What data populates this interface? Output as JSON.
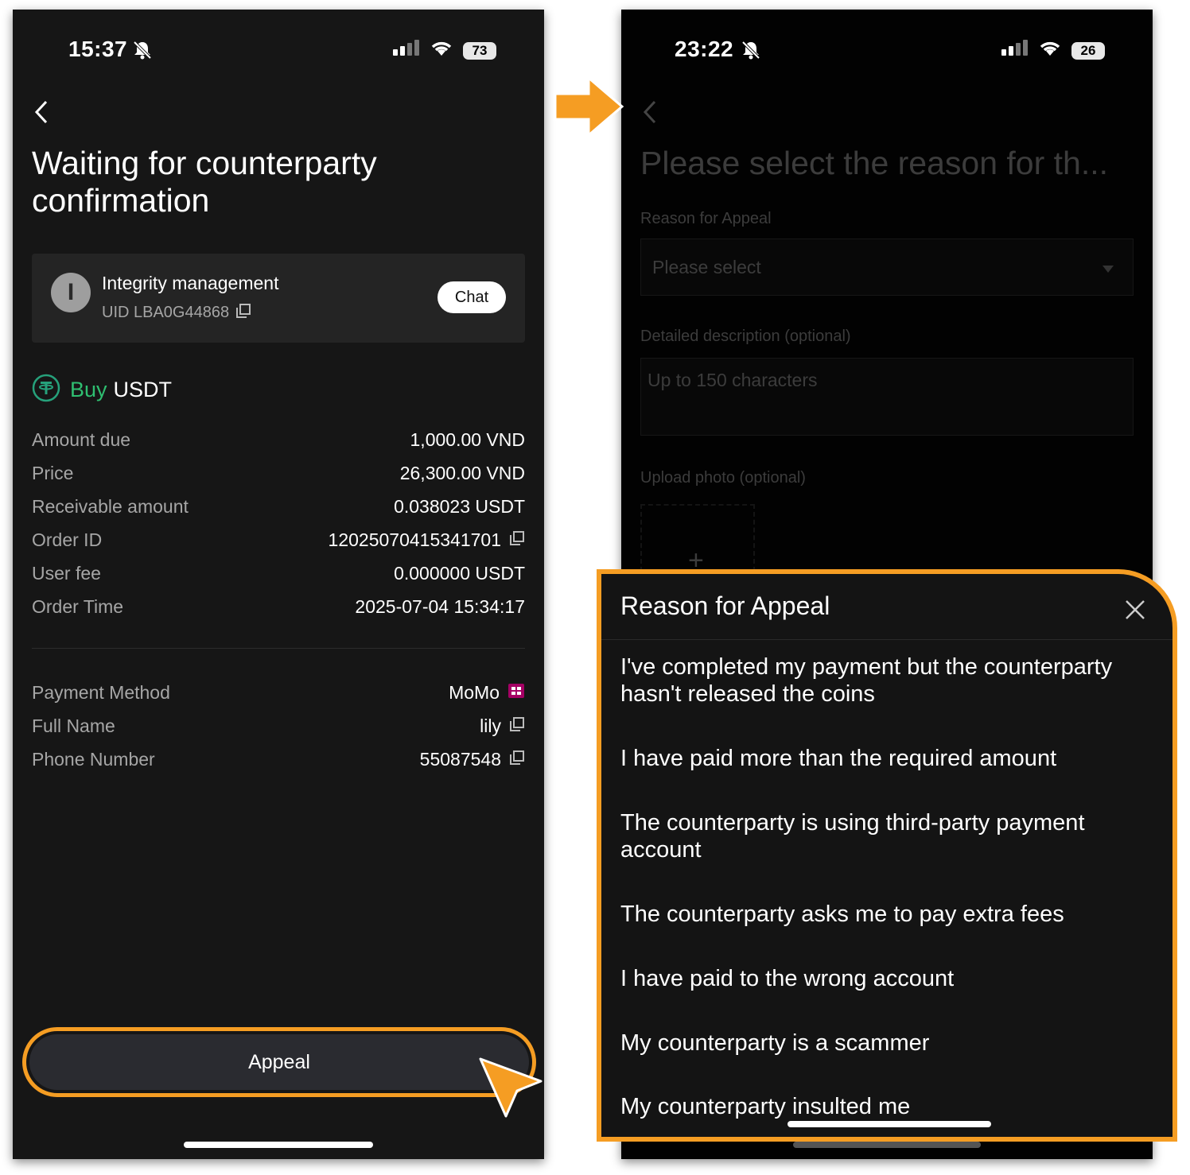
{
  "left_screen": {
    "status": {
      "time": "15:37",
      "battery": "73"
    },
    "title": "Waiting for counterparty confirmation",
    "counterparty": {
      "avatar_letter": "I",
      "name": "Integrity management",
      "uid": "UID LBA0G44868",
      "chat_label": "Chat"
    },
    "trade": {
      "side": "Buy",
      "asset": "USDT"
    },
    "details": [
      {
        "label": "Amount due",
        "value": "1,000.00 VND",
        "copy": false
      },
      {
        "label": "Price",
        "value": "26,300.00 VND",
        "copy": false
      },
      {
        "label": "Receivable amount",
        "value": "0.038023 USDT",
        "copy": false
      },
      {
        "label": "Order ID",
        "value": "12025070415341701",
        "copy": true
      },
      {
        "label": "User fee",
        "value": "0.000000 USDT",
        "copy": false
      },
      {
        "label": "Order Time",
        "value": "2025-07-04 15:34:17",
        "copy": false
      }
    ],
    "payment": [
      {
        "label": "Payment Method",
        "value": "MoMo",
        "icon": "momo-logo-icon"
      },
      {
        "label": "Full Name",
        "value": "lily",
        "icon": "copy-icon"
      },
      {
        "label": "Phone Number",
        "value": "55087548",
        "icon": "copy-icon"
      }
    ],
    "appeal_label": "Appeal"
  },
  "right_screen": {
    "status": {
      "time": "23:22",
      "battery": "26"
    },
    "title": "Please select the reason for th...",
    "reason_label": "Reason for Appeal",
    "select_placeholder": "Please select",
    "description_label": "Detailed description (optional)",
    "description_placeholder": "Up to 150 characters",
    "upload_label": "Upload photo (optional)",
    "upload_plus": "+"
  },
  "sheet": {
    "title": "Reason for Appeal",
    "reasons": [
      "I've completed my payment but the counterparty hasn't released the coins",
      "I have paid more than the required amount",
      "The counterparty is using third-party payment account",
      "The counterparty asks me to pay extra fees",
      "I have paid to the wrong account",
      "My counterparty is a scammer",
      "My counterparty insulted me"
    ]
  },
  "colors": {
    "accent_orange": "#f59d23",
    "buy_green": "#2fbf71",
    "tether_green": "#26a17b",
    "momo_pink": "#a50064"
  }
}
